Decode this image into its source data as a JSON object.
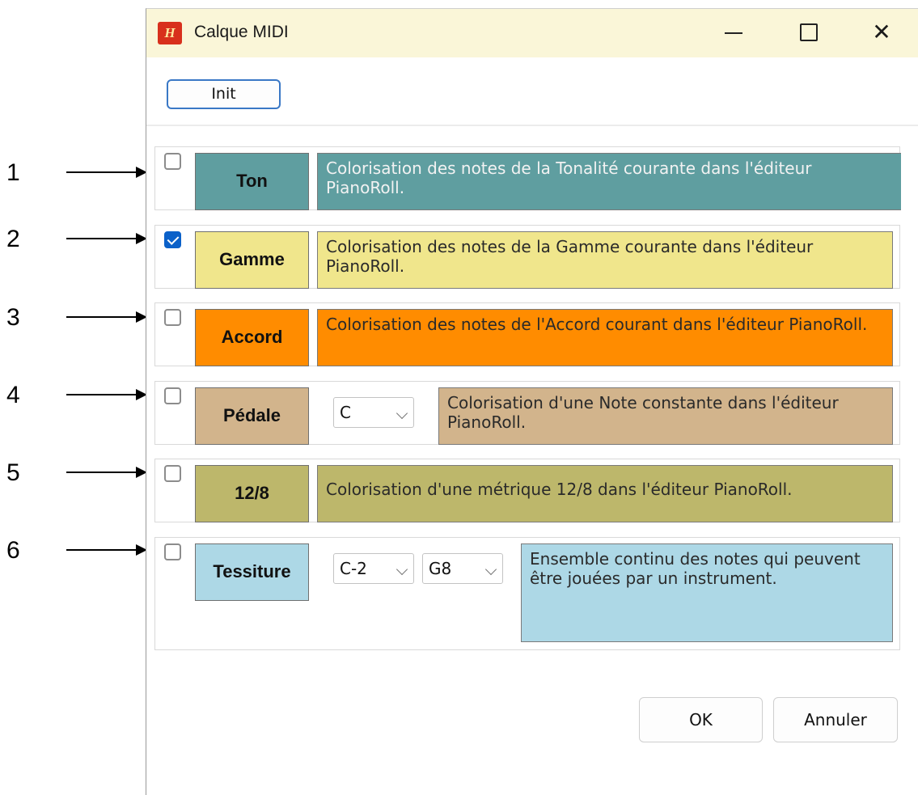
{
  "window": {
    "title": "Calque MIDI",
    "app_icon_text": "H"
  },
  "titlebar_controls": {
    "minimize": "minimize-icon",
    "maximize": "maximize-icon",
    "close": "✕"
  },
  "toolbar": {
    "init_label": "Init"
  },
  "annotations": [
    "1",
    "2",
    "3",
    "4",
    "5",
    "6"
  ],
  "layers": [
    {
      "label": "Ton",
      "checked": false,
      "color": "#5f9ea0",
      "text_color": "#f2f2f2",
      "description": "Colorisation des notes de la Tonalité courante dans l'éditeur PianoRoll."
    },
    {
      "label": "Gamme",
      "checked": true,
      "color": "#f0e68c",
      "text_color": "#2a2a2a",
      "description": "Colorisation des notes de la Gamme courante dans l'éditeur PianoRoll."
    },
    {
      "label": "Accord",
      "checked": false,
      "color": "#ff8c00",
      "text_color": "#2a2a2a",
      "description": "Colorisation des notes de l'Accord courant dans l'éditeur PianoRoll."
    },
    {
      "label": "Pédale",
      "checked": false,
      "color": "#d2b48c",
      "text_color": "#2a2a2a",
      "description": "Colorisation d'une Note constante dans l'éditeur PianoRoll.",
      "select": "C"
    },
    {
      "label": "12/8",
      "checked": false,
      "color": "#bdb76b",
      "text_color": "#2a2a2a",
      "description": "Colorisation d'une métrique 12/8 dans l'éditeur PianoRoll."
    },
    {
      "label": "Tessiture",
      "checked": false,
      "color": "#add8e6",
      "text_color": "#2a2a2a",
      "description": "Ensemble continu des notes qui peuvent être jouées par un instrument.",
      "select_low": "C-2",
      "select_high": "G8"
    }
  ],
  "footer": {
    "ok_label": "OK",
    "cancel_label": "Annuler"
  }
}
